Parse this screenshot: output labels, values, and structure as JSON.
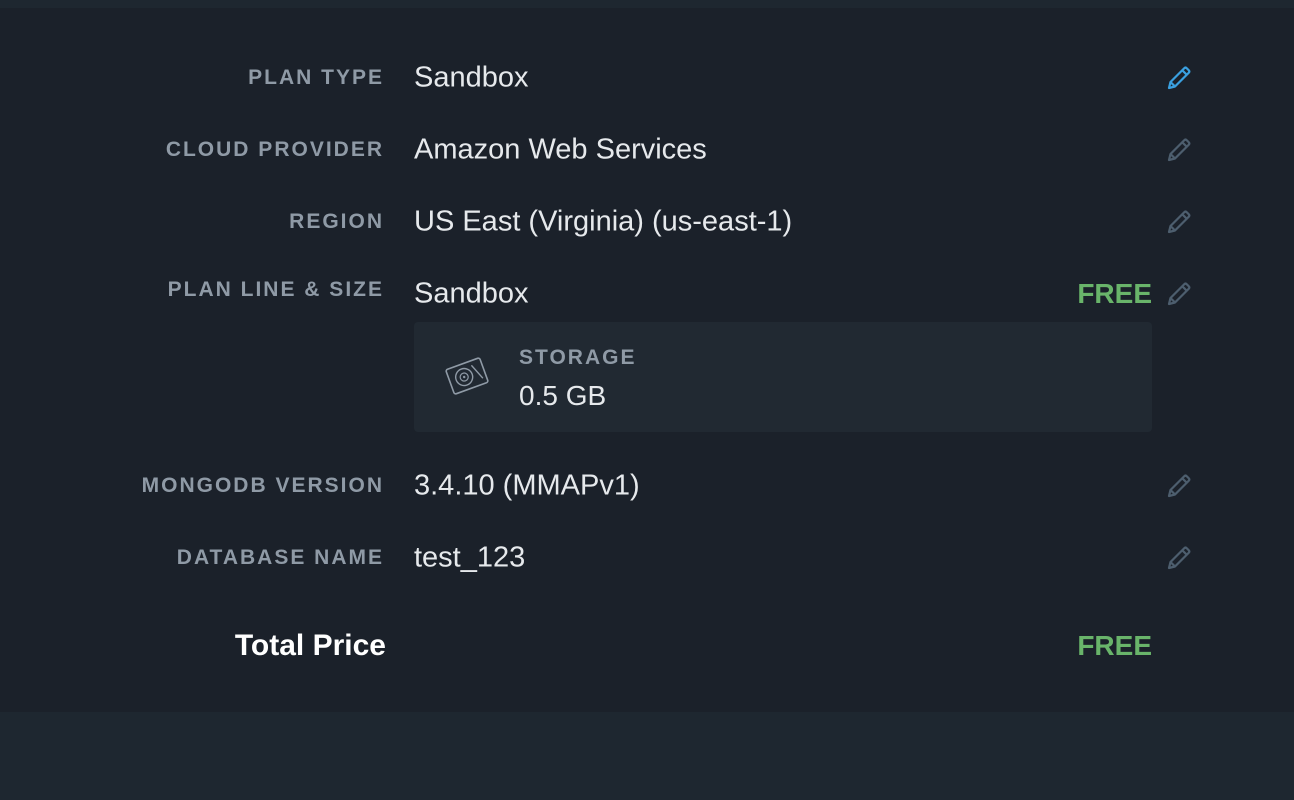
{
  "colors": {
    "background": "#1b212a",
    "label": "#8f9aa6",
    "value": "#e6e9ec",
    "price_free": "#69b46a",
    "edit_active": "#3aa0e0",
    "edit_inactive": "#4d5e6e"
  },
  "summary": {
    "rows": [
      {
        "label": "PLAN TYPE",
        "value": "Sandbox",
        "edit_icon": "pencil-icon",
        "edit_state": "active"
      },
      {
        "label": "CLOUD PROVIDER",
        "value": "Amazon Web Services",
        "edit_icon": "pencil-icon",
        "edit_state": "inactive"
      },
      {
        "label": "REGION",
        "value": "US East (Virginia) (us-east-1)",
        "edit_icon": "pencil-icon",
        "edit_state": "inactive"
      },
      {
        "label": "PLAN LINE & SIZE",
        "value": "Sandbox",
        "price": "FREE",
        "edit_icon": "pencil-icon",
        "edit_state": "inactive"
      },
      {
        "label": "MONGODB VERSION",
        "value": "3.4.10 (MMAPv1)",
        "edit_icon": "pencil-icon",
        "edit_state": "inactive"
      },
      {
        "label": "DATABASE NAME",
        "value": "test_123",
        "edit_icon": "pencil-icon",
        "edit_state": "inactive"
      }
    ],
    "storage": {
      "icon": "hard-drive-icon",
      "label": "STORAGE",
      "value": "0.5 GB"
    },
    "total": {
      "label": "Total Price",
      "price": "FREE"
    }
  }
}
